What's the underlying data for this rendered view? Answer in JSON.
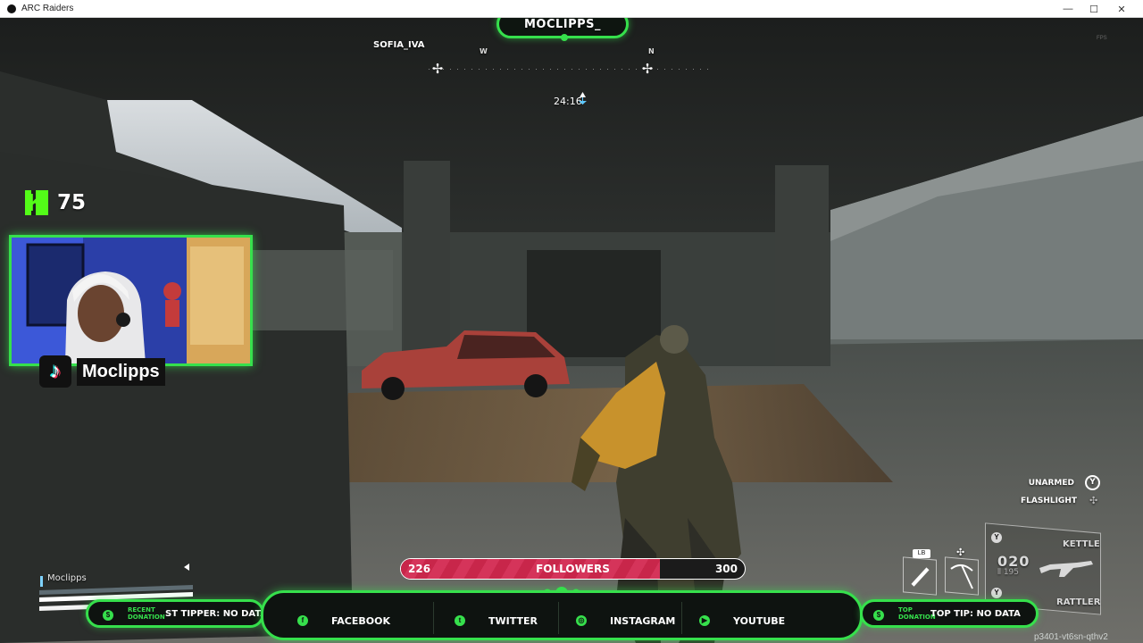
{
  "window": {
    "title": "ARC Raiders",
    "controls": [
      "—",
      "☐",
      "✕"
    ]
  },
  "hud": {
    "streamer_nameplate": "MOCLIPPS_",
    "teammate_name": "SOFIA_IVA",
    "compass_letters": [
      "W",
      "N"
    ],
    "match_timer": "24:16",
    "perf_overlay": "FPS"
  },
  "kick": {
    "viewer_count": "75",
    "brand_color": "#53fc18"
  },
  "webcam": {
    "platform_icon": "tiktok-icon",
    "handle": "Moclipps"
  },
  "player_status": {
    "name": "Moclipps"
  },
  "followers_goal": {
    "current": "226",
    "label": "FOLLOWERS",
    "goal": "300",
    "progress": 0.753
  },
  "weapon_hud": {
    "hint_unarmed": "UNARMED",
    "hint_flashlight": "FLASHLIGHT",
    "button_y": "Y",
    "slot_1_key": "LB",
    "primary_weapon": "KETTLE",
    "secondary_weapon": "RATTLER",
    "ammo_loaded": "020",
    "ammo_reserve": "195"
  },
  "footer": {
    "recent_donation_caption": "RECENT\nDONATION",
    "recent_donation_value": "ST TIPPER: NO DATA",
    "top_donation_caption": "TOP\nDONATION",
    "top_donation_value": "TOP TIP: NO DATA",
    "socials": [
      {
        "label": "FACEBOOK",
        "icon": "facebook-icon"
      },
      {
        "label": "TWITTER",
        "icon": "twitter-icon"
      },
      {
        "label": "INSTAGRAM",
        "icon": "instagram-icon"
      },
      {
        "label": "YOUTUBE",
        "icon": "youtube-icon"
      }
    ]
  },
  "build_id": "p3401-vt6sn-qthv2",
  "colors": {
    "overlay_accent": "#36e04c",
    "follower_bar": "#c8264a"
  }
}
